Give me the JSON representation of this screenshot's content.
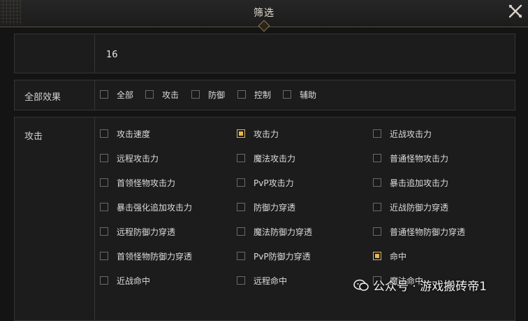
{
  "header": {
    "title": "筛选"
  },
  "level_row": {
    "value": "16"
  },
  "all_effects": {
    "label": "全部效果",
    "options": [
      {
        "label": "全部",
        "checked": false
      },
      {
        "label": "攻击",
        "checked": false
      },
      {
        "label": "防御",
        "checked": false
      },
      {
        "label": "控制",
        "checked": false
      },
      {
        "label": "辅助",
        "checked": false
      }
    ]
  },
  "attack": {
    "label": "攻击",
    "options": [
      {
        "label": "攻击速度",
        "checked": false
      },
      {
        "label": "攻击力",
        "checked": true
      },
      {
        "label": "近战攻击力",
        "checked": false
      },
      {
        "label": "远程攻击力",
        "checked": false
      },
      {
        "label": "魔法攻击力",
        "checked": false
      },
      {
        "label": "普通怪物攻击力",
        "checked": false
      },
      {
        "label": "首领怪物攻击力",
        "checked": false
      },
      {
        "label": "PvP攻击力",
        "checked": false
      },
      {
        "label": "暴击追加攻击力",
        "checked": false
      },
      {
        "label": "暴击强化追加攻击力",
        "checked": false
      },
      {
        "label": "防御力穿透",
        "checked": false
      },
      {
        "label": "近战防御力穿透",
        "checked": false
      },
      {
        "label": "远程防御力穿透",
        "checked": false
      },
      {
        "label": "魔法防御力穿透",
        "checked": false
      },
      {
        "label": "普通怪物防御力穿透",
        "checked": false
      },
      {
        "label": "首领怪物防御力穿透",
        "checked": false
      },
      {
        "label": "PvP防御力穿透",
        "checked": false
      },
      {
        "label": "命中",
        "checked": true
      },
      {
        "label": "近战命中",
        "checked": false
      },
      {
        "label": "远程命中",
        "checked": false
      },
      {
        "label": "魔法命中",
        "checked": false
      }
    ]
  },
  "watermark": {
    "text": "公众号 · 游戏搬砖帝1"
  }
}
